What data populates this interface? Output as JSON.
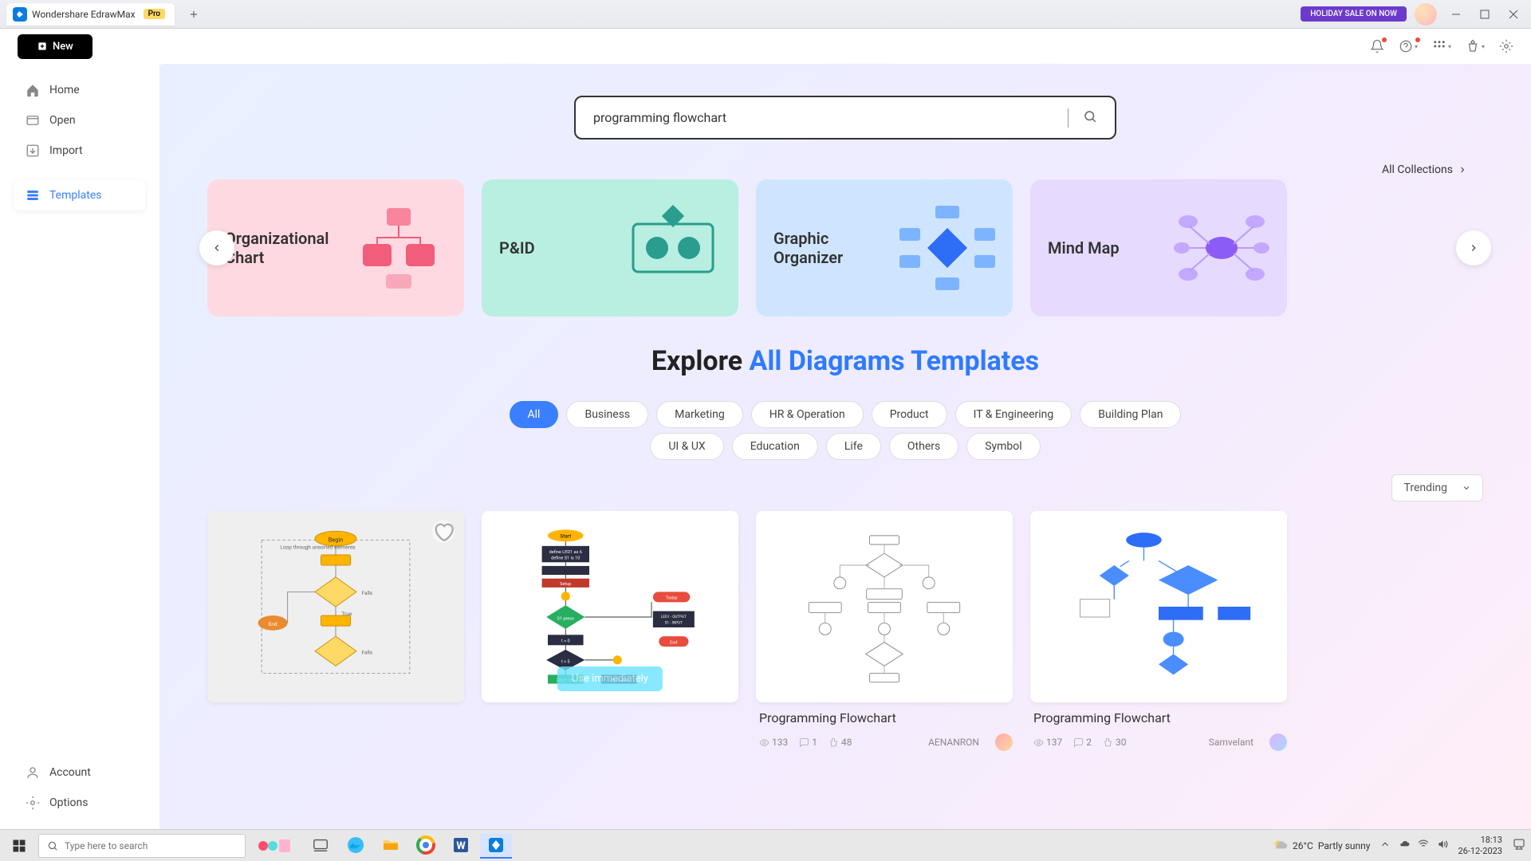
{
  "titlebar": {
    "app_name": "Wondershare EdrawMax",
    "badge": "Pro",
    "holiday": "HOLIDAY SALE ON NOW"
  },
  "toolbar": {
    "new_label": "New"
  },
  "sidebar": {
    "items": [
      {
        "label": "Home",
        "icon": "home"
      },
      {
        "label": "Open",
        "icon": "folder"
      },
      {
        "label": "Import",
        "icon": "import"
      },
      {
        "label": "Templates",
        "icon": "templates",
        "active": true
      }
    ],
    "footer": [
      {
        "label": "Account",
        "icon": "user"
      },
      {
        "label": "Options",
        "icon": "gear"
      }
    ]
  },
  "search": {
    "value": "programming flowchart"
  },
  "all_collections": "All Collections",
  "carousel": [
    {
      "title": "Organizational Chart"
    },
    {
      "title": "P&ID"
    },
    {
      "title": "Graphic Organizer"
    },
    {
      "title": "Mind Map"
    }
  ],
  "heading": {
    "prefix": "Explore ",
    "highlight": "All Diagrams Templates"
  },
  "categories": [
    "All",
    "Business",
    "Marketing",
    "HR & Operation",
    "Product",
    "IT & Engineering",
    "Building Plan",
    "UI & UX",
    "Education",
    "Life",
    "Others",
    "Symbol"
  ],
  "sort": {
    "label": "Trending"
  },
  "templates": [
    {
      "name": "",
      "views": "",
      "comments": "",
      "likes": "",
      "author": "",
      "use_label": "Use immediately"
    },
    {
      "name": "",
      "views": "",
      "comments": "",
      "likes": "",
      "author": ""
    },
    {
      "name": "Programming Flowchart",
      "views": "133",
      "comments": "1",
      "likes": "48",
      "author": "AENANRON"
    },
    {
      "name": "Programming Flowchart",
      "views": "137",
      "comments": "2",
      "likes": "30",
      "author": "Samvelant"
    }
  ],
  "taskbar": {
    "search_placeholder": "Type here to search",
    "weather_temp": "26°C",
    "weather_desc": "Partly sunny",
    "time": "18:13",
    "date": "26-12-2023"
  }
}
